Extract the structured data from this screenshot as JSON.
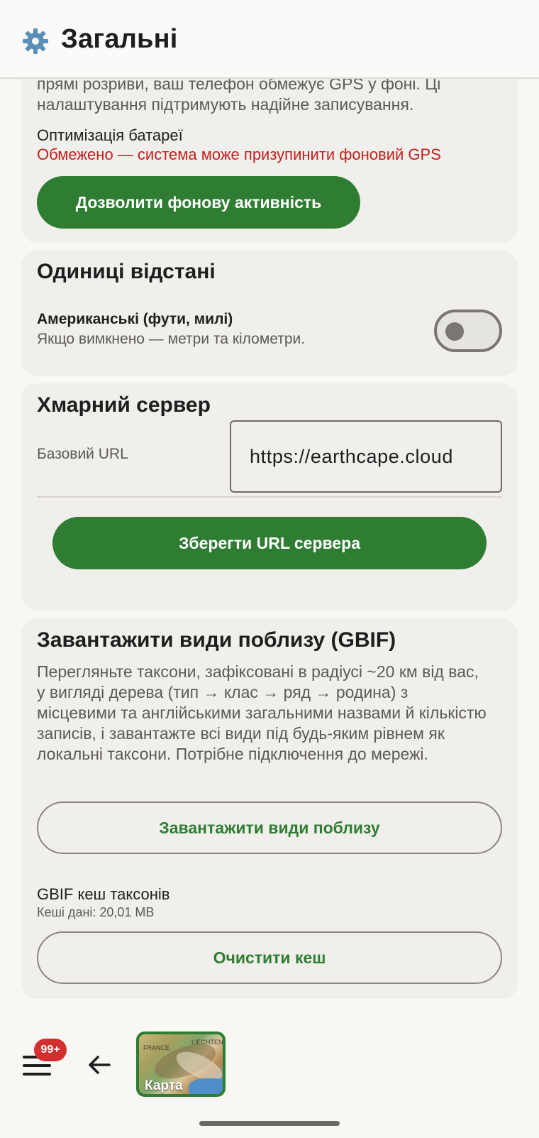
{
  "header": {
    "title": "Загальні",
    "icon": "gear-icon"
  },
  "background_activity": {
    "intro_text": "прямі розриви, ваш телефон обмежує GPS у фоні. Ці налаштування підтримують надійне записування.",
    "battery_label": "Оптимізація батареї",
    "battery_status": "Обмежено — система може призупинити фоновий GPS",
    "button_label": "Дозволити фонову активність"
  },
  "units": {
    "title": "Одиниці відстані",
    "option_label": "Американські (фути, милі)",
    "option_desc": "Якщо вимкнено — метри та кілометри.",
    "toggle_on": false
  },
  "cloud": {
    "title": "Хмарний сервер",
    "url_label": "Базовий URL",
    "url_value": "https://earthcape.cloud",
    "save_label": "Зберегти URL сервера"
  },
  "gbif": {
    "title": "Завантажити види поблизу (GBIF)",
    "description": "Перегляньте таксони, зафіксовані в радіусі ~20 км від вас, у вигляді дерева (тип → клас → ряд → родина) з місцевими та англійськими загальними назвами й кількістю записів, і завантажте всі види під будь-яким рівнем як локальні таксони. Потрібне підключення до мережі.",
    "load_button": "Завантажити види поблизу",
    "cache_label": "GBIF кеш таксонів",
    "cache_size": "Кеші дані: 20,01 MB",
    "clear_button": "Очистити кеш"
  },
  "bottom": {
    "badge": "99+",
    "map_label": "Карта",
    "map_text_1": "FRANCE",
    "map_text_2": "LIECHTENS"
  },
  "colors": {
    "accent": "#2e7d32",
    "warning": "#c0201e",
    "badge": "#d32f2f"
  }
}
